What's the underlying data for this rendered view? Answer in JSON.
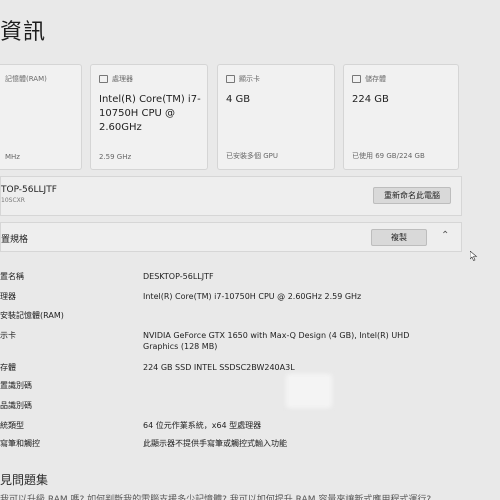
{
  "header": {
    "title": "資訊"
  },
  "cards": [
    {
      "label": "記憶體(RAM)",
      "value": "",
      "footer": "MHz",
      "icon": "memory-icon"
    },
    {
      "label": "處理器",
      "value": "Intel(R) Core(TM) i7-10750H CPU @ 2.60GHz",
      "footer": "2.59 GHz",
      "icon": "processor-icon"
    },
    {
      "label": "顯示卡",
      "value": "4 GB",
      "footer": "已安裝多個 GPU",
      "icon": "display-icon"
    },
    {
      "label": "儲存體",
      "value": "224 GB",
      "footer": "已使用 69 GB/224 GB",
      "icon": "storage-icon"
    }
  ],
  "device": {
    "name": "TOP-56LLJTF",
    "model": "10SCXR",
    "rename_button": "重新命名此電腦"
  },
  "specs": {
    "title": "置規格",
    "copy_button": "複製",
    "rows": [
      {
        "label": "置名稱",
        "value": "DESKTOP-56LLJTF"
      },
      {
        "label": "理器",
        "value": "Intel(R) Core(TM) i7-10750H CPU @ 2.60GHz   2.59 GHz"
      },
      {
        "label": "安裝記憶體(RAM)",
        "value": ""
      },
      {
        "label": "示卡",
        "value": "NVIDIA GeForce GTX 1650 with Max-Q Design (4 GB), Intel(R) UHD Graphics (128 MB)"
      },
      {
        "label": "存體",
        "value": "224 GB SSD INTEL SSDSC2BW240A3L"
      },
      {
        "label": "置識別碼",
        "value": ""
      },
      {
        "label": "品識別碼",
        "value": ""
      },
      {
        "label": "統類型",
        "value": "64 位元作業系統，x64 型處理器"
      },
      {
        "label": "寫筆和觸控",
        "value": "此顯示器不提供手寫筆或觸控式輸入功能"
      }
    ]
  },
  "help": {
    "title": "見問題集",
    "text": "我可以升級 RAM 嗎? 如何判斷我的電腦支援多少記憶體? 我可以如何提升 RAM 容量來讓新式應用程式運行?"
  }
}
